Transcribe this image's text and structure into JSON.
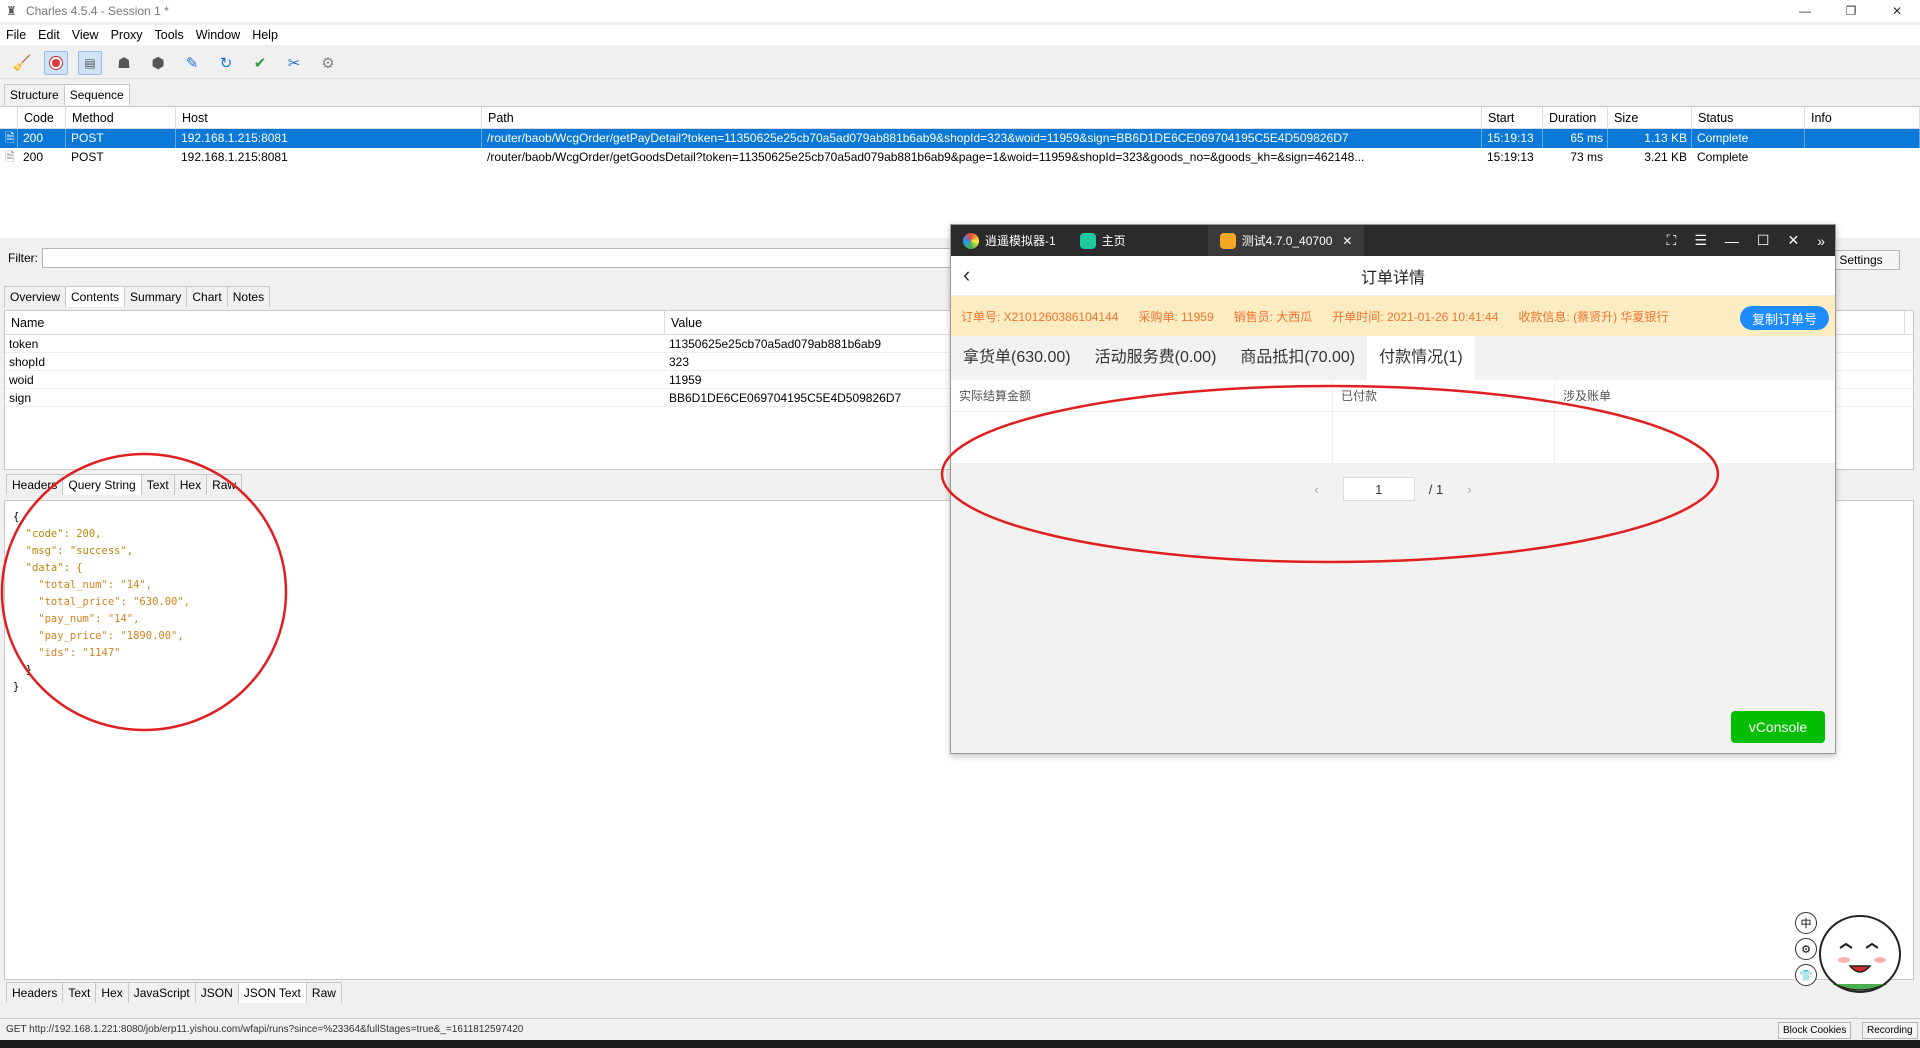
{
  "window": {
    "title": "Charles 4.5.4 - Session 1 *"
  },
  "menu": [
    "File",
    "Edit",
    "View",
    "Proxy",
    "Tools",
    "Window",
    "Help"
  ],
  "view_tabs": [
    "Structure",
    "Sequence"
  ],
  "table": {
    "columns": [
      "Code",
      "Method",
      "Host",
      "Path",
      "Start",
      "Duration",
      "Size",
      "Status",
      "Info"
    ],
    "rows": [
      {
        "code": "200",
        "method": "POST",
        "host": "192.168.1.215:8081",
        "path": "/router/baob/WcgOrder/getPayDetail?token=11350625e25cb70a5ad079ab881b6ab9&shopId=323&woid=11959&sign=BB6D1DE6CE069704195C5E4D509826D7",
        "start": "15:19:13",
        "duration": "65 ms",
        "size": "1.13 KB",
        "status": "Complete",
        "info": ""
      },
      {
        "code": "200",
        "method": "POST",
        "host": "192.168.1.215:8081",
        "path": "/router/baob/WcgOrder/getGoodsDetail?token=11350625e25cb70a5ad079ab881b6ab9&page=1&woid=11959&shopId=323&goods_no=&goods_kh=&sign=462148...",
        "start": "15:19:13",
        "duration": "73 ms",
        "size": "3.21 KB",
        "status": "Complete",
        "info": ""
      }
    ]
  },
  "filter": {
    "label": "Filter:",
    "value": "",
    "settings": "Settings"
  },
  "detail_tabs": [
    "Overview",
    "Contents",
    "Summary",
    "Chart",
    "Notes"
  ],
  "kv": {
    "headers": [
      "Name",
      "Value"
    ],
    "rows": [
      {
        "name": "token",
        "value": "11350625e25cb70a5ad079ab881b6ab9"
      },
      {
        "name": "shopId",
        "value": "323"
      },
      {
        "name": "woid",
        "value": "11959"
      },
      {
        "name": "sign",
        "value": "BB6D1DE6CE069704195C5E4D509826D7"
      }
    ]
  },
  "request_tabs": [
    "Headers",
    "Query String",
    "Text",
    "Hex",
    "Raw"
  ],
  "response_tabs": [
    "Headers",
    "Text",
    "Hex",
    "JavaScript",
    "JSON",
    "JSON Text",
    "Raw"
  ],
  "json_lines": [
    "{",
    "  \"code\": 200,",
    "  \"msg\": \"success\",",
    "  \"data\": {",
    "    \"total_num\": \"14\",",
    "    \"total_price\": \"630.00\",",
    "    \"pay_num\": \"14\",",
    "    \"pay_price\": \"1890.00\",",
    "    \"ids\": \"1147\"",
    "  }",
    "}"
  ],
  "status": {
    "url": "GET http://192.168.1.221:8080/job/erp11.yishou.com/wfapi/runs?since=%23364&fullStages=true&_=1611812597420",
    "block_cookies": "Block Cookies",
    "recording": "Recording"
  },
  "emulator": {
    "tabs": [
      "逍遥模拟器-1",
      "主页",
      "测试4.7.0_40700"
    ],
    "page_title": "订单详情",
    "info": {
      "order_no": "订单号: X2101260386104144",
      "purchase": "采购单: 11959",
      "seller": "销售员: 大西瓜",
      "open_time": "开单时间: 2021-01-26 10:41:44",
      "payee": "收款信息: (蔡贤升) 华夏银行",
      "copy_button": "复制订单号"
    },
    "tabs_content": [
      "拿货单(630.00)",
      "活动服务费(0.00)",
      "商品抵扣(70.00)",
      "付款情况(1)"
    ],
    "table_headers": [
      "实际结算金额",
      "已付款",
      "涉及账单"
    ],
    "pager": {
      "current": "1",
      "total": "/ 1"
    },
    "vconsole": "vConsole"
  },
  "side_icons": [
    "中",
    "⚙",
    "👕"
  ],
  "colors": {
    "selected_row": "#0a78d7",
    "annotation": "#e02020",
    "info_text": "#f0732f",
    "vconsole": "#04be02"
  }
}
